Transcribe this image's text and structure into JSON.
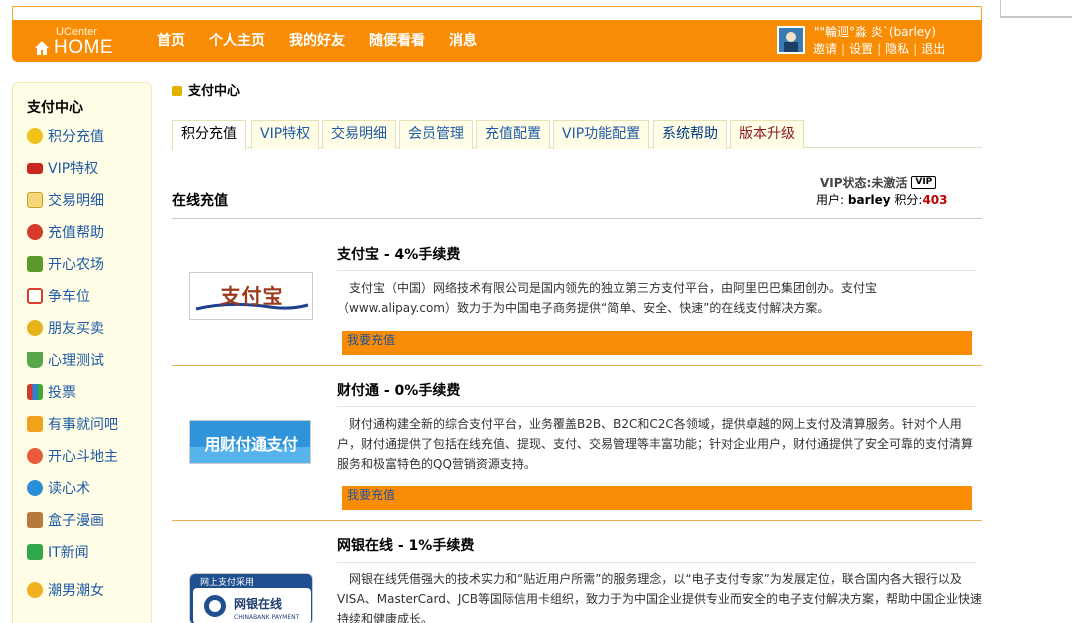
{
  "header": {
    "logo_small": "UCenter",
    "logo_big": "HOME",
    "nav": [
      "首页",
      "个人主页",
      "我的好友",
      "随便看看",
      "消息"
    ],
    "user_name": "\"\"輪迴°淼 炎`(barley)",
    "user_links": [
      "邀请",
      "设置",
      "隐私",
      "退出"
    ]
  },
  "sidebar": {
    "title": "支付中心",
    "items": [
      {
        "label": "积分充值",
        "icon": "coins-icon"
      },
      {
        "label": "VIP特权",
        "icon": "vip-icon"
      },
      {
        "label": "交易明细",
        "icon": "ledger-icon"
      },
      {
        "label": "充值帮助",
        "icon": "help-icon"
      },
      {
        "label": "开心农场",
        "icon": "farm-icon"
      },
      {
        "label": "争车位",
        "icon": "parking-icon"
      },
      {
        "label": "朋友买卖",
        "icon": "trade-icon"
      },
      {
        "label": "心理测试",
        "icon": "flask-icon"
      },
      {
        "label": "投票",
        "icon": "vote-icon"
      },
      {
        "label": "有事就问吧",
        "icon": "question-icon"
      },
      {
        "label": "开心斗地主",
        "icon": "cards-icon"
      },
      {
        "label": "读心术",
        "icon": "mind-icon"
      },
      {
        "label": "盒子漫画",
        "icon": "comic-icon"
      },
      {
        "label": "IT新闻",
        "icon": "news-icon"
      },
      {
        "label": "潮男潮女",
        "icon": "couple-icon"
      }
    ]
  },
  "main": {
    "title": "支付中心",
    "tabs": [
      "积分充值",
      "VIP特权",
      "交易明细",
      "会员管理",
      "充值配置",
      "VIP功能配置",
      "系统帮助",
      "版本升级"
    ],
    "section_title": "在线充值",
    "vip_status": "VIP状态:未激活",
    "vip_badge": "VIP",
    "user_label": "用户:",
    "user_value": "barley",
    "score_label": "积分:",
    "score_value": "403"
  },
  "payments": [
    {
      "name": "支付宝",
      "fee": " - 4%手续费",
      "logo_text": "支付宝",
      "desc": "支付宝（中国）网络技术有限公司是国内领先的独立第三方支付平台，由阿里巴巴集团创办。支付宝（www.alipay.com）致力于为中国电子商务提供“简单、安全、快速”的在线支付解决方案。",
      "button": "我要充值"
    },
    {
      "name": "财付通",
      "fee": " - 0%手续费",
      "logo_text": "用财付通支付",
      "desc": "财付通构建全新的综合支付平台，业务覆盖B2B、B2C和C2C各领域，提供卓越的网上支付及清算服务。针对个人用户，财付通提供了包括在线充值、提现、支付、交易管理等丰富功能；针对企业用户，财付通提供了安全可靠的支付清算服务和极富特色的QQ营销资源支持。",
      "button": "我要充值"
    },
    {
      "name": "网银在线",
      "fee": " - 1%手续费",
      "logo_text": "网银在线",
      "logo_top": "网上支付采用",
      "logo_sub": "CHINABANK PAYMENT",
      "desc": "网银在线凭借强大的技术实力和“贴近用户所需”的服务理念，以“电子支付专家”为发展定位，联合国内各大银行以及VISA、MasterCard、JCB等国际信用卡组织，致力于为中国企业提供专业而安全的电子支付解决方案，帮助中国企业快速持续和健康成长。"
    }
  ],
  "colors": {
    "header_orange": "#f88d05",
    "link_blue": "#1f5aa6",
    "score_red": "#c00000"
  }
}
